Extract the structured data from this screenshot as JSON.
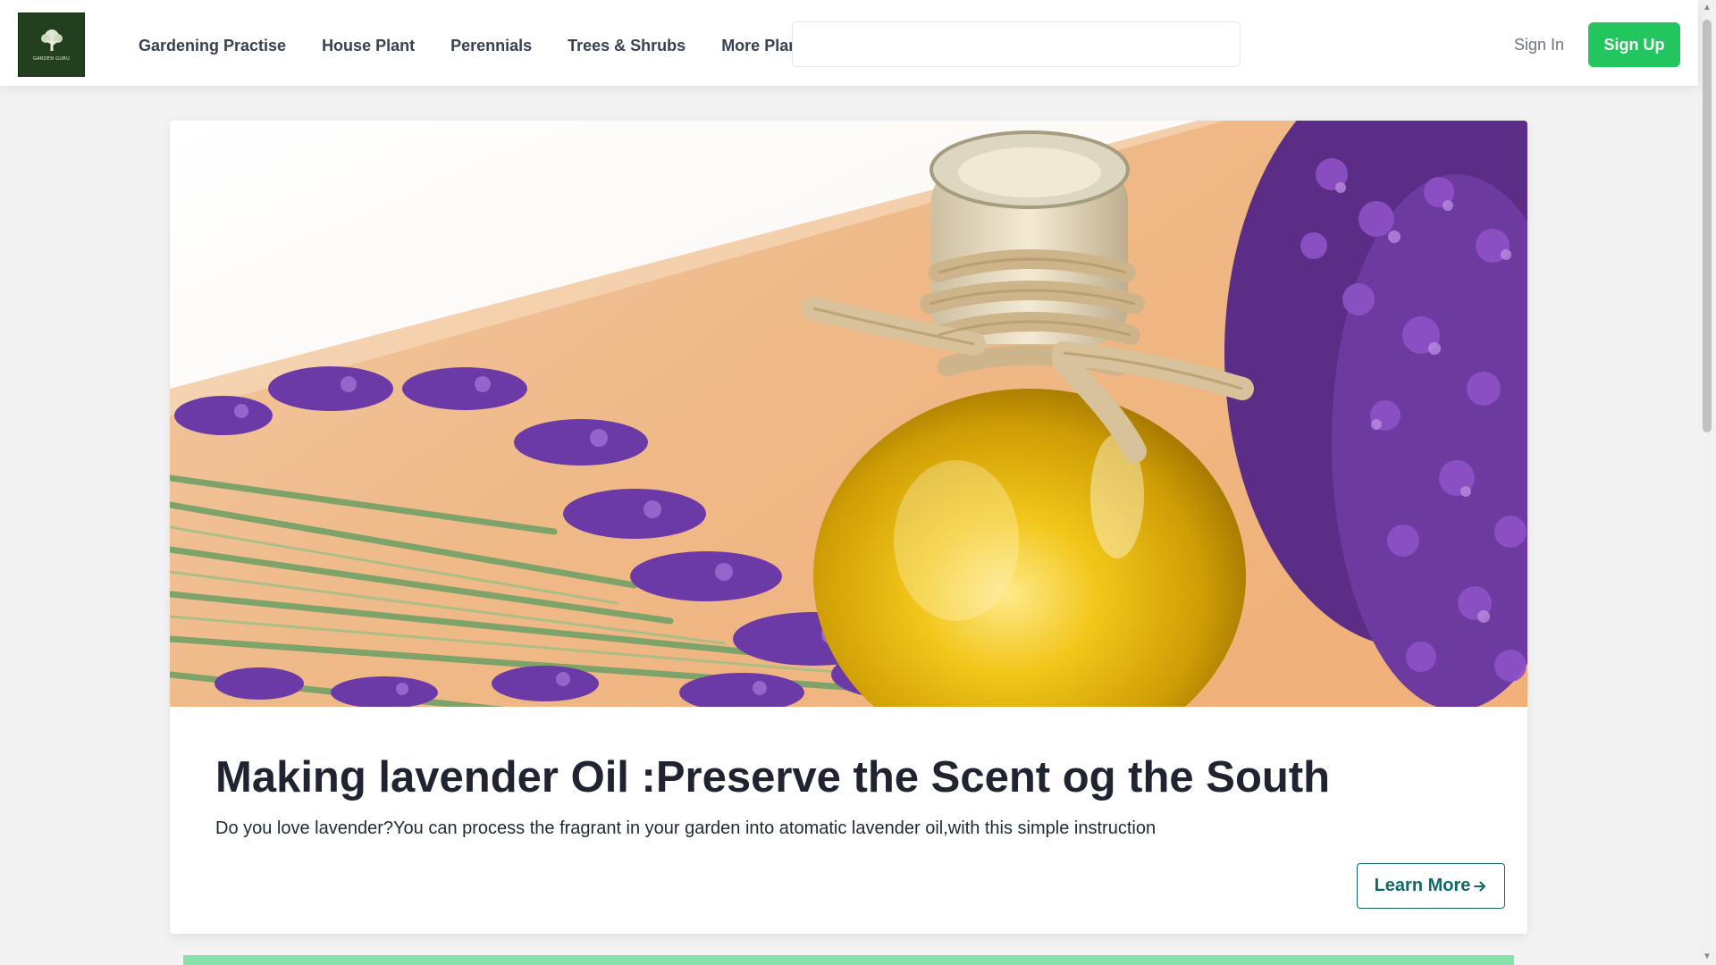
{
  "logo": {
    "text": "GARDEN GURU"
  },
  "nav": {
    "items": [
      {
        "label": "Gardening Practise"
      },
      {
        "label": "House Plant"
      },
      {
        "label": "Perennials"
      },
      {
        "label": "Trees & Shrubs"
      },
      {
        "label": "More Plants"
      }
    ]
  },
  "search": {
    "value": "",
    "placeholder": ""
  },
  "auth": {
    "sign_in": "Sign In",
    "sign_up": "Sign Up"
  },
  "article": {
    "title": "Making lavender Oil :Preserve the Scent og the South",
    "description": "Do you love lavender?You can process the fragrant in your garden into atomatic lavender oil,with this simple instruction",
    "cta": "Learn More",
    "cta_icon": "arrow-right-icon",
    "image": "lavender-oil-bottle-photo"
  },
  "colors": {
    "accent_green": "#22c55e",
    "cta_teal": "#0f6a6a",
    "logo_bg": "#22401d",
    "strip_green": "#86e0a8"
  }
}
